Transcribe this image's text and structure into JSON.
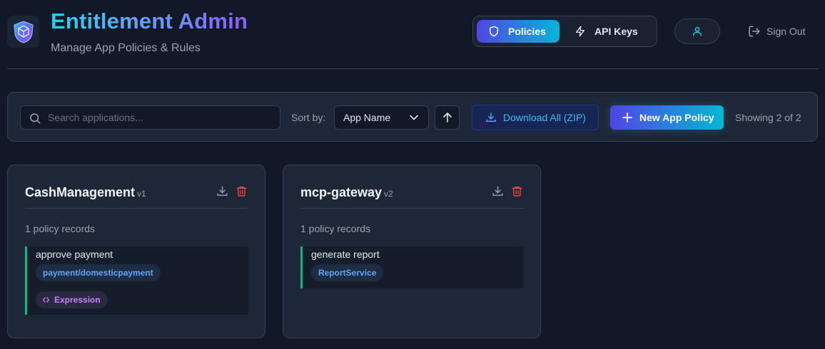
{
  "header": {
    "title": "Entitlement Admin",
    "subtitle": "Manage App Policies & Rules",
    "nav": [
      {
        "label": "Policies",
        "icon": "shield-icon",
        "active": true
      },
      {
        "label": "API Keys",
        "icon": "lightning-icon",
        "active": false
      }
    ],
    "user_icon": "user-icon",
    "sign_out": "Sign Out"
  },
  "toolbar": {
    "search_placeholder": "Search applications...",
    "search_value": "",
    "sort_label": "Sort by:",
    "sort_value": "App Name",
    "sort_direction": "ascending",
    "download_all": "Download All (ZIP)",
    "new_policy": "New App Policy",
    "showing": "Showing 2 of 2"
  },
  "apps": [
    {
      "name": "CashManagement",
      "version": "v1",
      "count": "1 policy records",
      "records": [
        {
          "name": "approve payment",
          "resource": "payment/domesticpayment",
          "type": "Expression"
        }
      ]
    },
    {
      "name": "mcp-gateway",
      "version": "v2",
      "count": "1 policy records",
      "records": [
        {
          "name": "generate report",
          "resource": "ReportService"
        }
      ]
    }
  ],
  "colors": {
    "background": "#111827",
    "accent_start": "#4f46e5",
    "accent_end": "#06b6d4",
    "record_border": "#10b981",
    "delete": "#ef4444",
    "resource_text": "#60a5fa",
    "expression_text": "#c084fc"
  }
}
